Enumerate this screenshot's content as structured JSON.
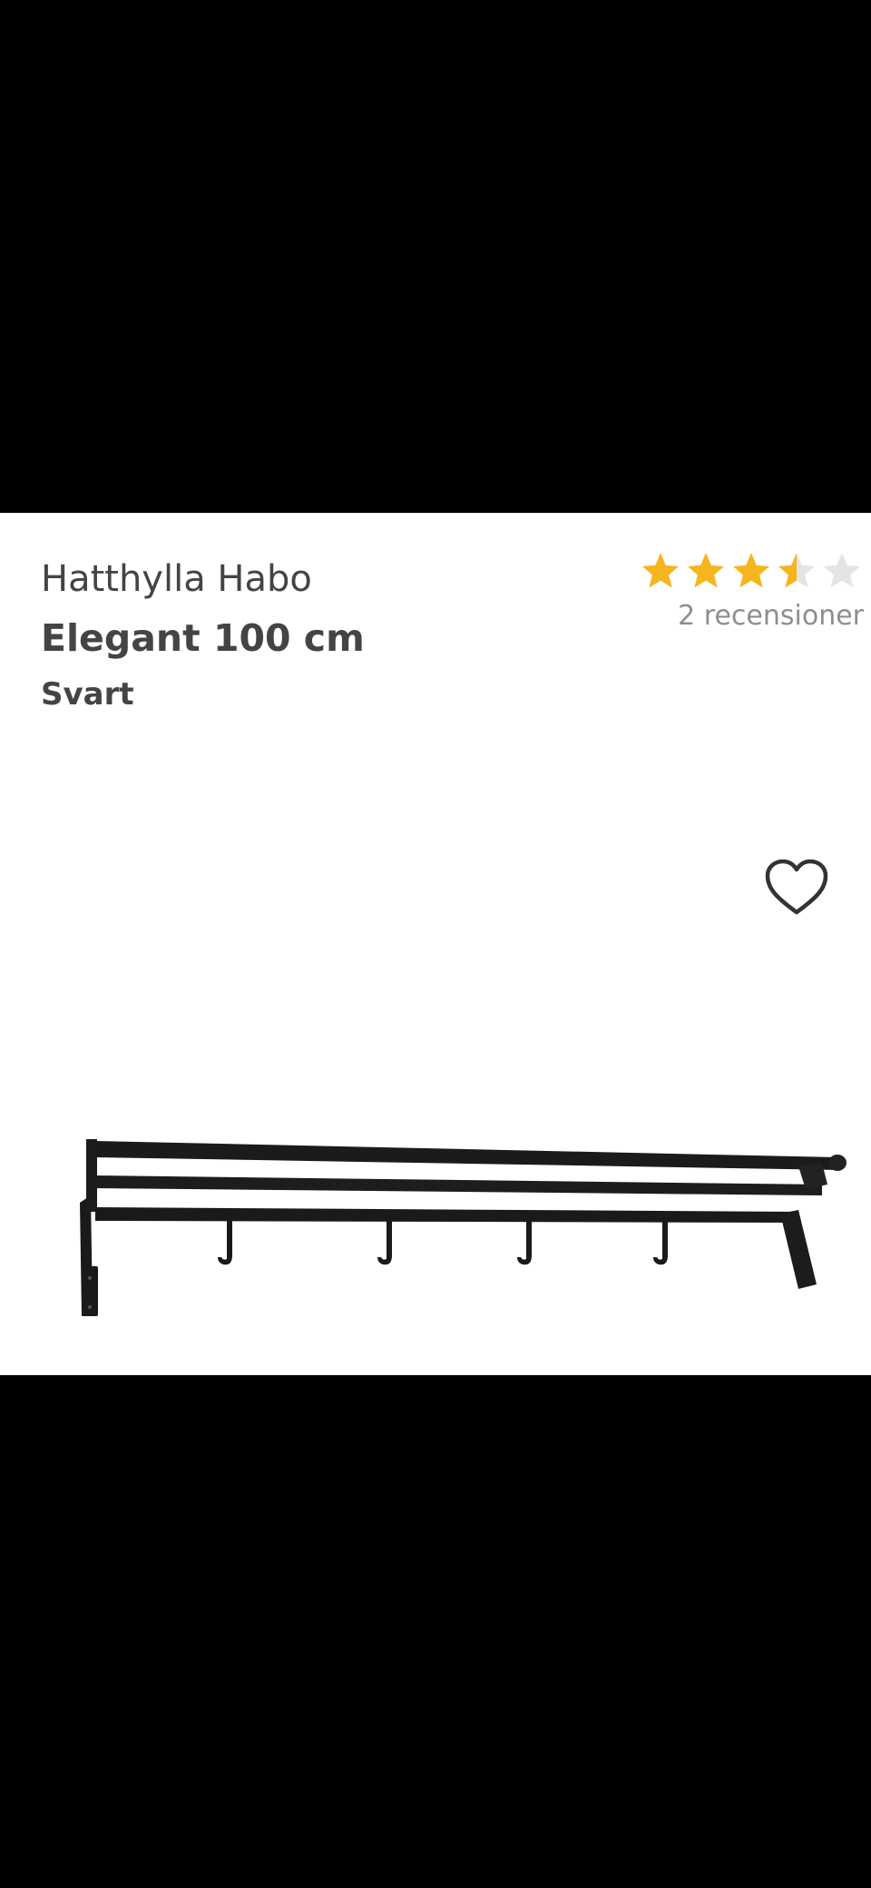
{
  "product": {
    "brand": "Hatthylla Habo",
    "model": "Elegant 100 cm",
    "color_name": "Svart"
  },
  "rating": {
    "stars": 3.5,
    "max_stars": 5,
    "reviews_label": "2 recensioner",
    "star_color": "#f5b51f",
    "empty_star_color": "#e4e4e4"
  },
  "favorite": {
    "icon": "heart-outline-icon"
  },
  "colors": {
    "background_outside": "#000000",
    "card_background": "#ffffff",
    "text": "#444444",
    "muted_text": "#8e8e8e"
  }
}
